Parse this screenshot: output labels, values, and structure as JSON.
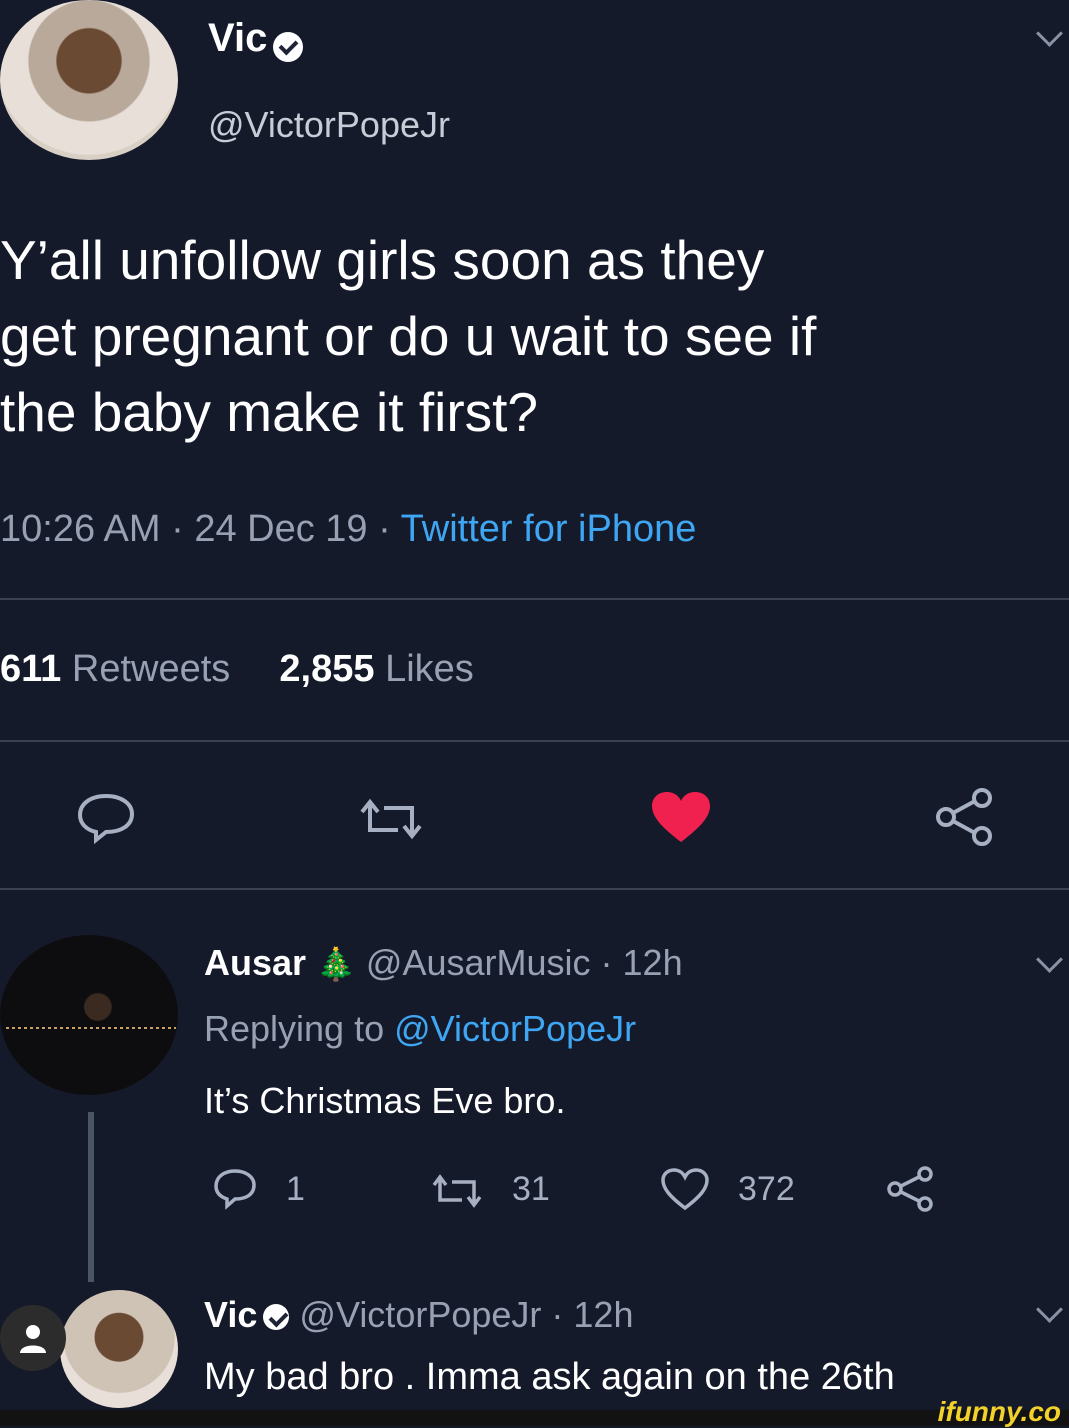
{
  "tweet": {
    "author_name": "Vic",
    "author_handle": "@VictorPopeJr",
    "text_lines": [
      "Y’all unfollow girls soon as they",
      "get pregnant or do u wait to see if",
      "the baby make it first?"
    ],
    "time": "10:26 AM",
    "date": "24 Dec 19",
    "source": "Twitter for iPhone",
    "retweets_count": "611",
    "retweets_label": "Retweets",
    "likes_count": "2,855",
    "likes_label": "Likes"
  },
  "reply1": {
    "name": "Ausar",
    "emoji": "🎄",
    "handle": "@AusarMusic",
    "time": "· 12h",
    "replying_label": "Replying to",
    "replying_to": "@VictorPopeJr",
    "text": "It’s Christmas Eve bro.",
    "replies": "1",
    "retweets": "31",
    "likes": "372"
  },
  "reply2": {
    "name": "Vic",
    "handle": "@VictorPopeJr",
    "time": "· 12h",
    "text": "My bad bro . Imma ask again on the 26th"
  },
  "watermark": "ifunny.co",
  "colors": {
    "background": "#151a2b",
    "link": "#3ea6f2",
    "like": "#f0204f"
  }
}
